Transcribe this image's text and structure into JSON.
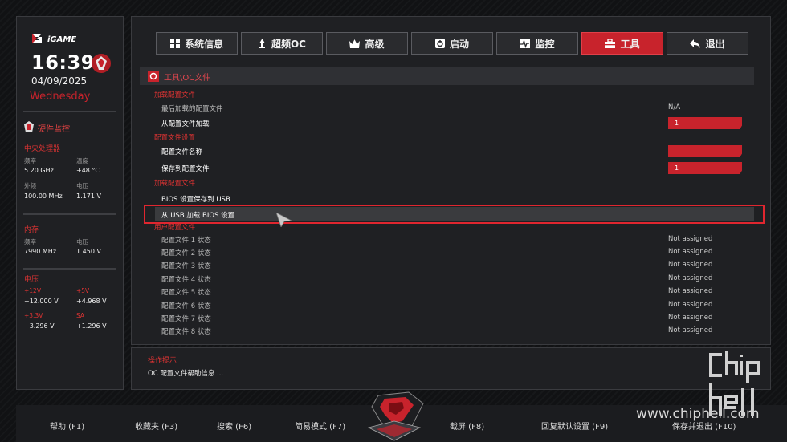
{
  "brand": {
    "logo_text": "iGAME"
  },
  "clock": {
    "time": "16:39",
    "date": "04/09/2025",
    "day": "Wednesday"
  },
  "monitor": {
    "title": "硬件监控",
    "cpu": {
      "title": "中央处理器",
      "freq_label": "频率",
      "freq": "5.20 GHz",
      "temp_label": "温度",
      "temp": "+48 °C",
      "bclk_label": "外频",
      "bclk": "100.00 MHz",
      "vcore_label": "电压",
      "vcore": "1.171 V"
    },
    "mem": {
      "title": "内存",
      "freq_label": "频率",
      "freq": "7990 MHz",
      "volt_label": "电压",
      "volt": "1.450 V"
    },
    "voltage": {
      "title": "电压",
      "v12_label": "+12V",
      "v12": "+12.000 V",
      "v5_label": "+5V",
      "v5": "+4.968 V",
      "v33_label": "+3.3V",
      "v33": "+3.296 V",
      "sa_label": "SA",
      "sa": "+1.296 V"
    }
  },
  "tabs": [
    {
      "label": "系统信息",
      "icon": "grid-icon"
    },
    {
      "label": "超频OC",
      "icon": "rocket-icon"
    },
    {
      "label": "高级",
      "icon": "crown-icon"
    },
    {
      "label": "启动",
      "icon": "power-icon"
    },
    {
      "label": "监控",
      "icon": "pulse-icon"
    },
    {
      "label": "工具",
      "icon": "toolbox-icon"
    },
    {
      "label": "退出",
      "icon": "back-arrow-icon"
    }
  ],
  "active_tab": 5,
  "breadcrumb": "工具\\OC文件",
  "content": {
    "g1": "加载配置文件",
    "last_loaded_label": "最后加载的配置文件",
    "last_loaded_value": "N/A",
    "load_from_label": "从配置文件加载",
    "load_from_value": "1",
    "g2": "配置文件设置",
    "name_label": "配置文件名称",
    "name_value": "",
    "save_to_label": "保存到配置文件",
    "save_to_value": "1",
    "g3": "加载配置文件",
    "save_usb_label": "BIOS 设置保存到 USB",
    "load_usb_label": "从 USB 加载 BIOS 设置",
    "g4": "用户配置文件",
    "profiles": [
      {
        "label": "配置文件 1 状态",
        "value": "Not assigned"
      },
      {
        "label": "配置文件 2 状态",
        "value": "Not assigned"
      },
      {
        "label": "配置文件 3 状态",
        "value": "Not assigned"
      },
      {
        "label": "配置文件 4 状态",
        "value": "Not assigned"
      },
      {
        "label": "配置文件 5 状态",
        "value": "Not assigned"
      },
      {
        "label": "配置文件 6 状态",
        "value": "Not assigned"
      },
      {
        "label": "配置文件 7 状态",
        "value": "Not assigned"
      },
      {
        "label": "配置文件 8 状态",
        "value": "Not assigned"
      }
    ]
  },
  "help": {
    "title": "操作提示",
    "text": "OC 配置文件帮助信息 ..."
  },
  "fkeys": [
    "帮助 (F1)",
    "收藏夹 (F3)",
    "搜索 (F6)",
    "简易模式 (F7)",
    "截屏 (F8)",
    "回复默认设置 (F9)",
    "保存并退出 (F10)"
  ],
  "watermark": "www.chiphell.com",
  "colors": {
    "accent": "#c8232c",
    "panel": "#1f2023",
    "highlight": "#e0262f"
  }
}
